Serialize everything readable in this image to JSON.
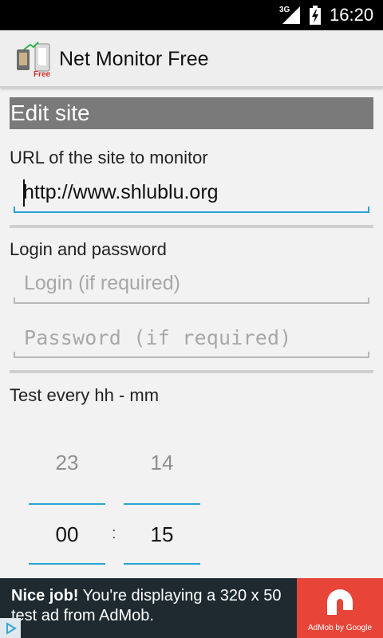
{
  "status_bar": {
    "network": "3G",
    "time": "16:20"
  },
  "app": {
    "title": "Net Monitor Free",
    "logo_badge": "Free"
  },
  "section_title": "Edit site",
  "url_section": {
    "label": "URL of the site to monitor",
    "value": "http://www.shlublu.org"
  },
  "auth_section": {
    "label": "Login and password",
    "login_placeholder": "Login (if required)",
    "password_placeholder": "Password (if required)"
  },
  "interval_section": {
    "label": "Test every hh - mm",
    "hours": {
      "previous": "23",
      "current": "00"
    },
    "minutes": {
      "previous": "14",
      "current": "15"
    },
    "separator": ":"
  },
  "ad": {
    "headline": "Nice job!",
    "body": " You're displaying a 320 x 50 test ad from AdMob.",
    "brand": "AdMob by Google",
    "colors": {
      "tile": "#e84438",
      "background": "#1e2a2f"
    }
  },
  "colors": {
    "accent": "#29a3d4",
    "section_header": "#7a7a7a"
  }
}
